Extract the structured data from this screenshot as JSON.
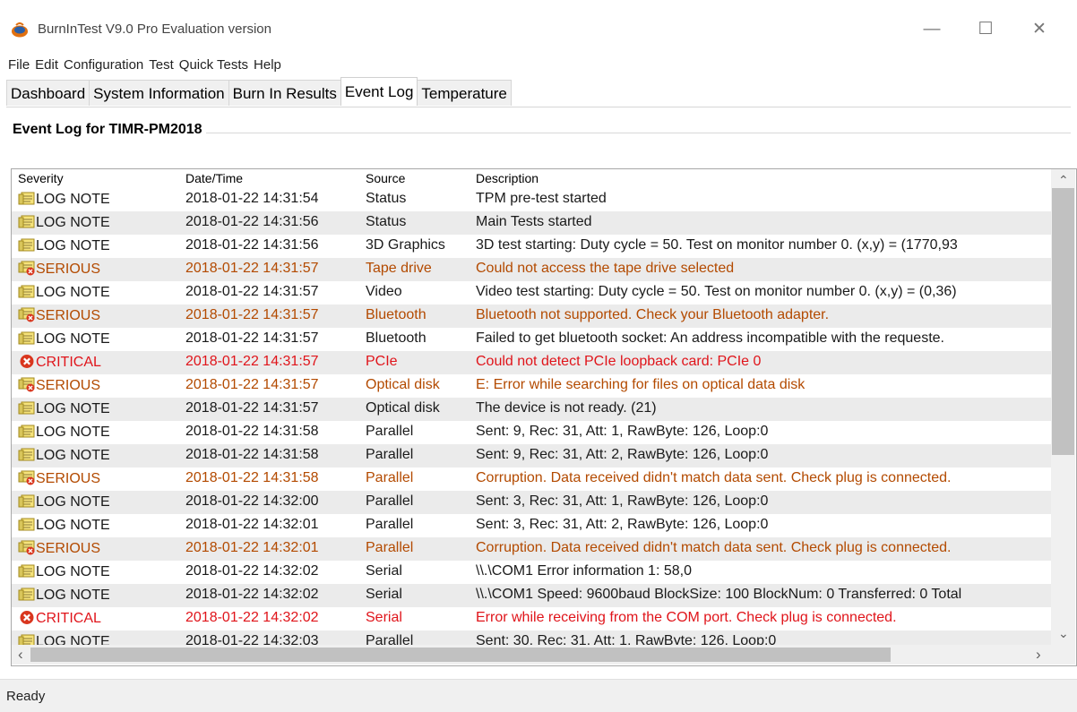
{
  "window": {
    "title": "BurnInTest V9.0 Pro Evaluation version",
    "minimize_glyph": "—",
    "maximize_glyph": "☐",
    "close_glyph": "✕"
  },
  "menu": [
    "File",
    "Edit",
    "Configuration",
    "Test",
    "Quick Tests",
    "Help"
  ],
  "tabs": [
    {
      "label": "Dashboard",
      "active": false
    },
    {
      "label": "System Information",
      "active": false
    },
    {
      "label": "Burn In Results",
      "active": false
    },
    {
      "label": "Event Log",
      "active": true
    },
    {
      "label": "Temperature",
      "active": false
    }
  ],
  "event_log": {
    "group_title": "Event Log for TIMR-PM2018",
    "columns": {
      "severity": "Severity",
      "datetime": "Date/Time",
      "source": "Source",
      "description": "Description"
    },
    "rows": [
      {
        "severity": "LOG NOTE",
        "level": "log",
        "datetime": "2018-01-22 14:31:54",
        "source": "Status",
        "description": "TPM pre-test started"
      },
      {
        "severity": "LOG NOTE",
        "level": "log",
        "datetime": "2018-01-22 14:31:56",
        "source": "Status",
        "description": "Main Tests started"
      },
      {
        "severity": "LOG NOTE",
        "level": "log",
        "datetime": "2018-01-22 14:31:56",
        "source": "3D Graphics",
        "description": "3D test starting: Duty cycle = 50. Test on monitor number 0. (x,y) = (1770,93"
      },
      {
        "severity": "SERIOUS",
        "level": "serious",
        "datetime": "2018-01-22 14:31:57",
        "source": "Tape drive",
        "description": "Could not access the tape drive selected"
      },
      {
        "severity": "LOG NOTE",
        "level": "log",
        "datetime": "2018-01-22 14:31:57",
        "source": "Video",
        "description": "Video test starting: Duty cycle = 50. Test on monitor number 0. (x,y) = (0,36)"
      },
      {
        "severity": "SERIOUS",
        "level": "serious",
        "datetime": "2018-01-22 14:31:57",
        "source": "Bluetooth",
        "description": "Bluetooth not supported. Check your Bluetooth adapter."
      },
      {
        "severity": "LOG NOTE",
        "level": "log",
        "datetime": "2018-01-22 14:31:57",
        "source": "Bluetooth",
        "description": "Failed to get bluetooth socket: An address incompatible with the requeste."
      },
      {
        "severity": "CRITICAL",
        "level": "critical",
        "datetime": "2018-01-22 14:31:57",
        "source": "PCIe",
        "description": "Could not detect PCIe loopback card: PCIe 0"
      },
      {
        "severity": "SERIOUS",
        "level": "serious",
        "datetime": "2018-01-22 14:31:57",
        "source": "Optical disk",
        "description": "E: Error while searching for files on optical data disk"
      },
      {
        "severity": "LOG NOTE",
        "level": "log",
        "datetime": "2018-01-22 14:31:57",
        "source": "Optical disk",
        "description": "The device is not ready.  (21)"
      },
      {
        "severity": "LOG NOTE",
        "level": "log",
        "datetime": "2018-01-22 14:31:58",
        "source": "Parallel",
        "description": "Sent: 9, Rec: 31, Att: 1, RawByte: 126, Loop:0"
      },
      {
        "severity": "LOG NOTE",
        "level": "log",
        "datetime": "2018-01-22 14:31:58",
        "source": "Parallel",
        "description": "Sent: 9, Rec: 31, Att: 2, RawByte: 126, Loop:0"
      },
      {
        "severity": "SERIOUS",
        "level": "serious",
        "datetime": "2018-01-22 14:31:58",
        "source": "Parallel",
        "description": "Corruption. Data received didn't match data sent. Check plug is connected."
      },
      {
        "severity": "LOG NOTE",
        "level": "log",
        "datetime": "2018-01-22 14:32:00",
        "source": "Parallel",
        "description": "Sent: 3, Rec: 31, Att: 1, RawByte: 126, Loop:0"
      },
      {
        "severity": "LOG NOTE",
        "level": "log",
        "datetime": "2018-01-22 14:32:01",
        "source": "Parallel",
        "description": "Sent: 3, Rec: 31, Att: 2, RawByte: 126, Loop:0"
      },
      {
        "severity": "SERIOUS",
        "level": "serious",
        "datetime": "2018-01-22 14:32:01",
        "source": "Parallel",
        "description": "Corruption. Data received didn't match data sent. Check plug is connected."
      },
      {
        "severity": "LOG NOTE",
        "level": "log",
        "datetime": "2018-01-22 14:32:02",
        "source": "Serial",
        "description": "\\\\.\\COM1 Error information 1: 58,0"
      },
      {
        "severity": "LOG NOTE",
        "level": "log",
        "datetime": "2018-01-22 14:32:02",
        "source": "Serial",
        "description": "\\\\.\\COM1 Speed: 9600baud BlockSize: 100 BlockNum: 0 Transferred: 0 Total"
      },
      {
        "severity": "CRITICAL",
        "level": "critical",
        "datetime": "2018-01-22 14:32:02",
        "source": "Serial",
        "description": "Error while receiving from the COM port. Check plug is connected."
      },
      {
        "severity": "LOG NOTE",
        "level": "log",
        "datetime": "2018-01-22 14:32:03",
        "source": "Parallel",
        "description": "Sent: 30, Rec: 31, Att: 1, RawByte: 126, Loop:0"
      }
    ]
  },
  "scrollbars": {
    "up": "⌃",
    "down": "⌄",
    "left": "‹",
    "right": "›"
  },
  "icons": {
    "log": "notepad-icon",
    "serious": "notepad-error-icon",
    "critical": "error-circle-icon"
  },
  "colors": {
    "log_text": "#1a1a1a",
    "serious_text": "#b34a00",
    "critical_text": "#e0141a"
  },
  "status": {
    "text": "Ready"
  }
}
